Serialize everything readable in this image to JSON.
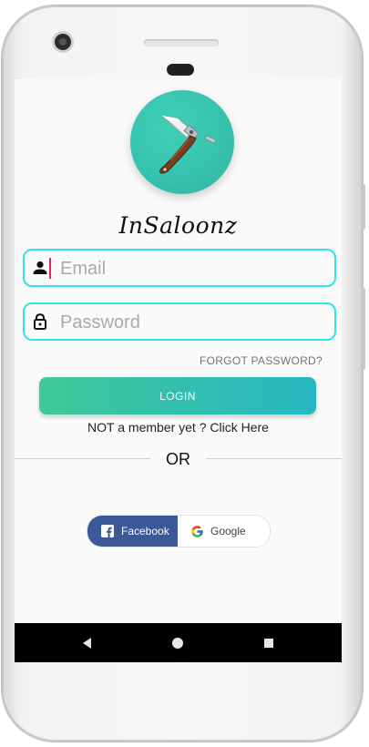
{
  "app": {
    "title": "InSaloonz"
  },
  "form": {
    "email_placeholder": "Email",
    "password_placeholder": "Password",
    "forgot_label": "FORGOT PASSWORD?",
    "login_label": "LOGIN",
    "signup_text": "NOT a member yet ? Click Here",
    "or_text": "OR"
  },
  "social": {
    "facebook_label": "Facebook",
    "google_label": "Google"
  },
  "icons": {
    "logo": "straight-razor-icon",
    "email": "person-icon",
    "password": "lock-icon",
    "facebook": "facebook-icon",
    "google": "google-icon",
    "nav_back": "back-triangle-icon",
    "nav_home": "home-circle-icon",
    "nav_recents": "recents-square-icon"
  },
  "colors": {
    "field_border": "#2ee6e6",
    "login_gradient_start": "#3fc996",
    "login_gradient_end": "#26b8c2",
    "facebook_blue": "#3b5998",
    "logo_teal": "#36c3ae"
  }
}
